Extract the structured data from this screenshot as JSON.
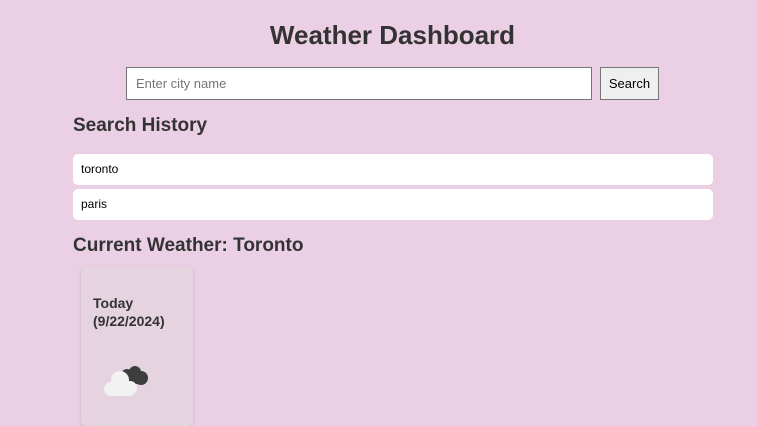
{
  "header": {
    "title": "Weather Dashboard"
  },
  "search": {
    "placeholder": "Enter city name",
    "value": "",
    "button_label": "Search"
  },
  "history": {
    "heading": "Search History",
    "items": [
      "toronto",
      "paris"
    ]
  },
  "current": {
    "heading": "Current Weather: Toronto",
    "cards": [
      {
        "day_label": "Today",
        "date": "(9/22/2024)",
        "icon": "clouds-icon"
      }
    ]
  },
  "colors": {
    "background": "#ebcfe5",
    "card_background": "#e5d3e0",
    "text": "#333333"
  }
}
